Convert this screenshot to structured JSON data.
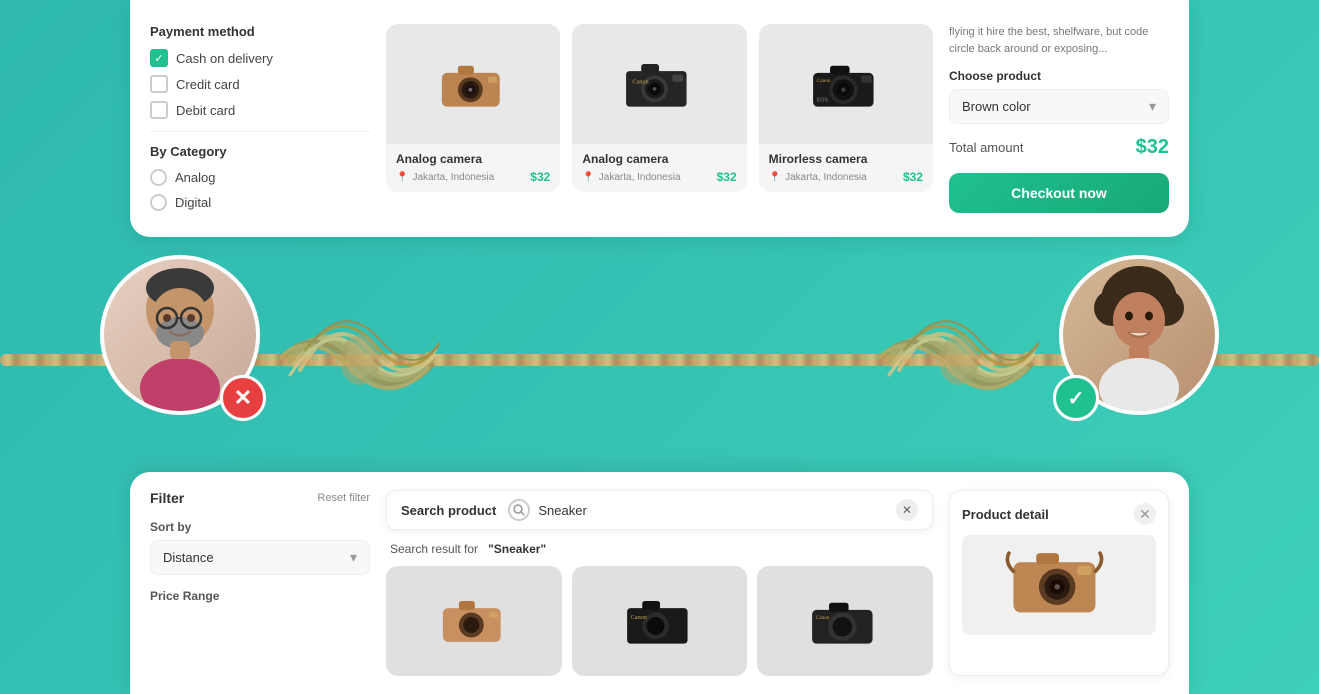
{
  "background_color": "#3db8b0",
  "top_card": {
    "payment_section": {
      "title": "Payment method",
      "options": [
        {
          "label": "Cash on delivery",
          "checked": true
        },
        {
          "label": "Credit card",
          "checked": false
        },
        {
          "label": "Debit card",
          "checked": false
        }
      ]
    },
    "category_section": {
      "title": "By Category",
      "options": [
        {
          "label": "Analog",
          "selected": false
        },
        {
          "label": "Digital",
          "selected": false
        }
      ]
    },
    "products": [
      {
        "name": "Analog camera",
        "location": "Jakarta, Indonesia",
        "price": "$32"
      },
      {
        "name": "Analog camera",
        "location": "Jakarta, Indonesia",
        "price": "$32"
      },
      {
        "name": "Mirorless camera",
        "location": "Jakarta, Indonesia",
        "price": "$32"
      }
    ],
    "right_panel": {
      "description": "flying it hire the best, shelfware, but code circle back around or exposing...",
      "choose_label": "Choose product",
      "dropdown_value": "Brown color",
      "total_label": "Total amount",
      "total_amount": "$32",
      "checkout_btn": "Checkout now"
    }
  },
  "bottom_card": {
    "filter": {
      "title": "Filter",
      "reset_label": "Reset filter"
    },
    "sort": {
      "label": "Sort by",
      "value": "Distance"
    },
    "price_range": {
      "label": "Price Range"
    },
    "search": {
      "label": "Search product",
      "placeholder": "Sneaker",
      "value": "Sneaker",
      "result_prefix": "Search result for",
      "result_query": "\"Sneaker\""
    },
    "product_detail": {
      "title": "Product detail"
    }
  }
}
